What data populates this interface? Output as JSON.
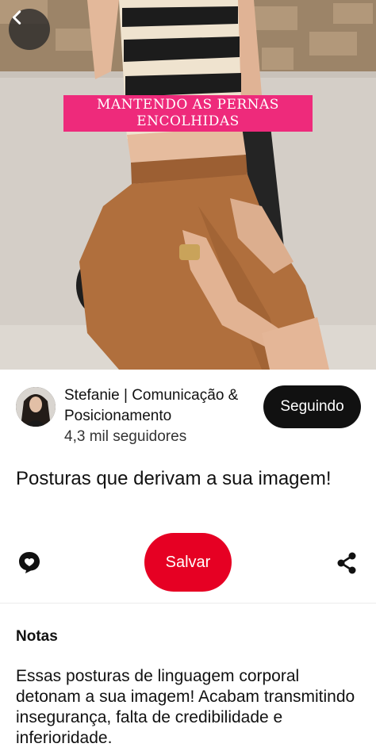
{
  "hero": {
    "caption_line1": "MANTENDO AS PERNAS",
    "caption_line2": "ENCOLHIDAS"
  },
  "creator": {
    "name": "Stefanie | Comunicação & Posicionamento",
    "followers": "4,3 mil seguidores",
    "follow_label": "Seguindo"
  },
  "pin": {
    "title": "Posturas que derivam a sua imagem!"
  },
  "actions": {
    "save_label": "Salvar"
  },
  "notes": {
    "heading": "Notas",
    "body": "Essas posturas de linguagem corporal detonam a sua imagem! Acabam transmitindo insegurança, falta de credibilidade e inferioridade."
  },
  "colors": {
    "save": "#e60023",
    "caption_bg": "#ee2a7b",
    "follow_bg": "#111111"
  },
  "icons": [
    "chevron-left-icon",
    "comment-icon",
    "share-icon"
  ]
}
